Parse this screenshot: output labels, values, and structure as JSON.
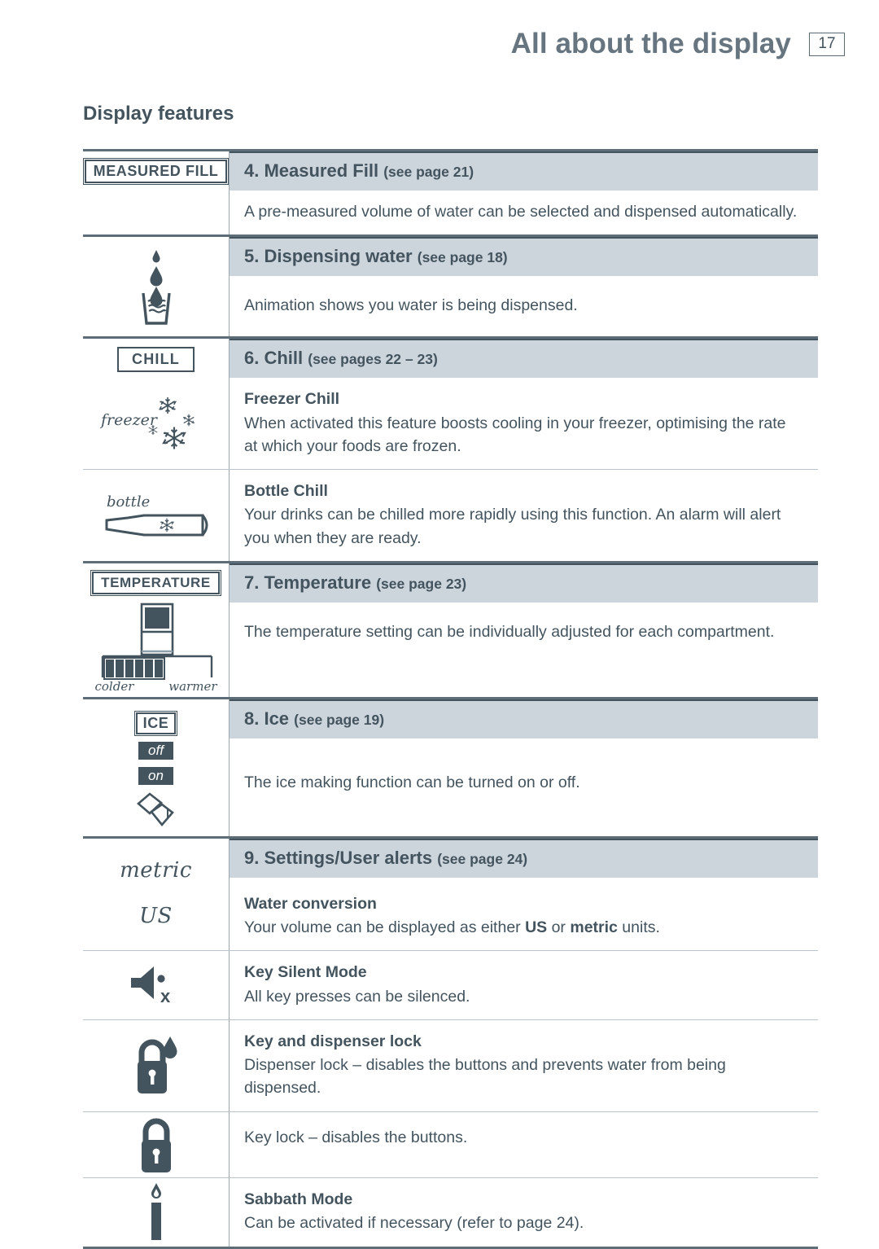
{
  "header": {
    "title": "All about the display",
    "page_number": "17"
  },
  "section": {
    "title": "Display features"
  },
  "colors": {
    "ink": "#44545e",
    "header_title": "#66757f",
    "bar_bg": "#ccd4dc",
    "rule": "#5d6e78",
    "light_rule": "#b9c3cb"
  },
  "features": [
    {
      "id": "measured-fill",
      "icon": "measured-fill-badge",
      "icon_label": "MEASURED FILL",
      "bar_title": "4. Measured Fill",
      "bar_ref": "(see page 21)",
      "body": "A pre-measured volume of water can be selected and dispensed automatically."
    },
    {
      "id": "dispensing-water",
      "icon": "water-drops-glass-icon",
      "bar_title": "5. Dispensing water",
      "bar_ref": "(see page 18)",
      "body": "Animation shows you water is being dispensed."
    },
    {
      "id": "chill",
      "icon": "chill-badge",
      "icon_label": "CHILL",
      "bar_title": "6. Chill",
      "bar_ref": "(see pages 22 – 23)",
      "sub_rows": [
        {
          "id": "freezer-chill",
          "icon": "freezer-snowflakes-icon",
          "icon_label": "freezer",
          "title": "Freezer Chill",
          "body": "When activated this feature boosts cooling in your freezer, optimising the rate at which your foods are frozen."
        },
        {
          "id": "bottle-chill",
          "icon": "bottle-snowflake-icon",
          "icon_label": "bottle",
          "title": "Bottle Chill",
          "body": "Your drinks can be chilled more rapidly using this function. An alarm will alert you when they are ready."
        }
      ]
    },
    {
      "id": "temperature",
      "icon": "temperature-badge",
      "icon_label": "TEMPERATURE",
      "icon_label_left": "colder",
      "icon_label_right": "warmer",
      "bar_title": "7. Temperature",
      "bar_ref": "(see page 23)",
      "body": "The temperature setting can be individually adjusted for each compartment."
    },
    {
      "id": "ice",
      "icon": "ice-badge",
      "icon_label": "ICE",
      "icon_state_off": "off",
      "icon_state_on": "on",
      "bar_title": "8. Ice",
      "bar_ref": "(see page 19)",
      "body": "The ice making function can be turned on or off."
    },
    {
      "id": "settings-user-alerts",
      "icon": "units-metric-us-icon",
      "icon_label_metric": "metric",
      "icon_label_us": "US",
      "bar_title": "9. Settings/User alerts",
      "bar_ref": "(see page 24)",
      "sub_rows": [
        {
          "id": "water-conversion",
          "icon": "units-metric-us-icon",
          "title": "Water conversion",
          "body_prefix": "Your volume can be displayed as either ",
          "body_bold1": "US",
          "body_mid": " or ",
          "body_bold2": "metric",
          "body_suffix": " units."
        },
        {
          "id": "key-silent-mode",
          "icon": "speaker-mute-icon",
          "title": "Key Silent Mode",
          "body": "All key presses can be silenced."
        },
        {
          "id": "key-dispenser-lock",
          "icon": "padlock-drop-icon",
          "title": "Key and dispenser lock",
          "body": "Dispenser lock – disables the buttons and prevents water from being dispensed."
        },
        {
          "id": "key-lock",
          "icon": "padlock-icon",
          "title": "",
          "body": "Key lock – disables the buttons."
        },
        {
          "id": "sabbath-mode",
          "icon": "candle-icon",
          "title": "Sabbath Mode",
          "body": "Can be activated if necessary (refer to page 24)."
        }
      ]
    }
  ]
}
